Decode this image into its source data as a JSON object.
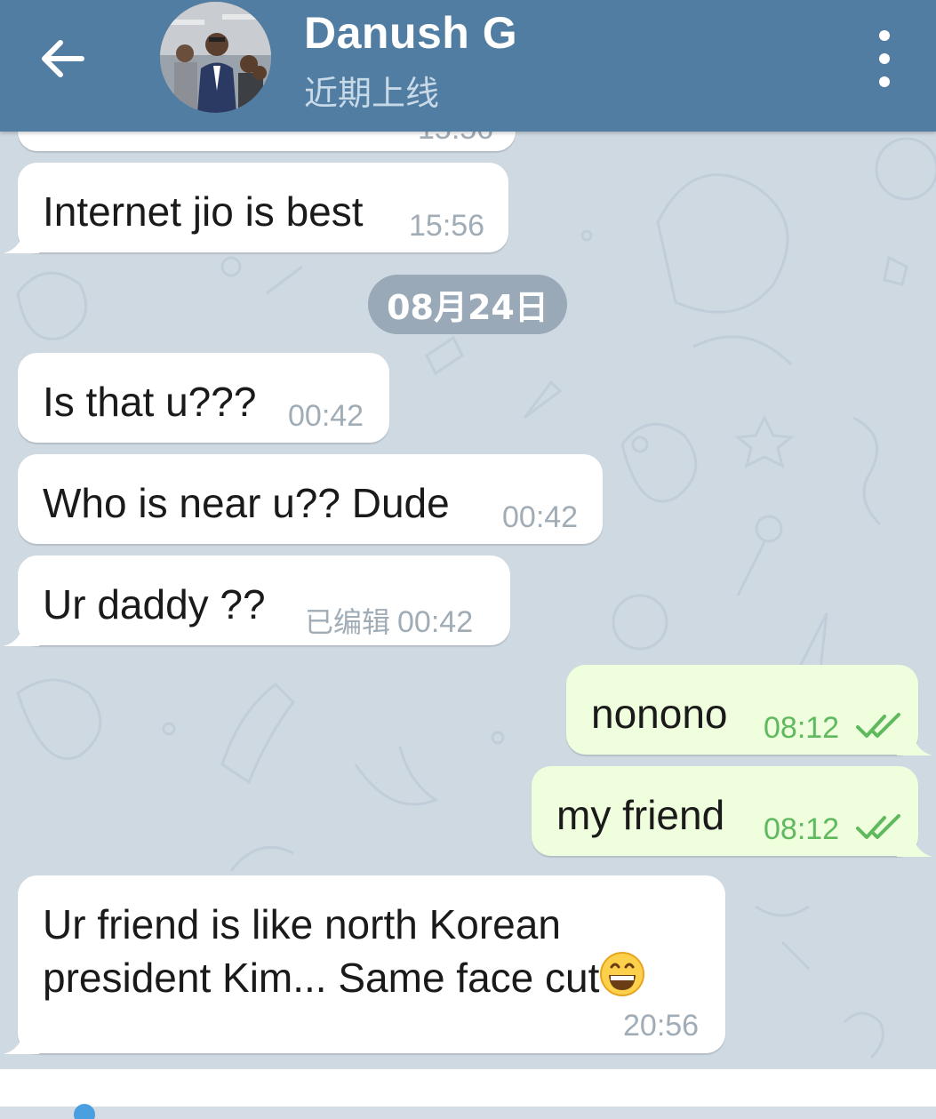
{
  "header": {
    "title": "Danush G",
    "subtitle": "近期上线",
    "accent_color": "#517da2",
    "back_icon": "arrow-left-icon",
    "menu_icon": "more-vertical-icon"
  },
  "messages": [
    {
      "direction": "in",
      "text": "Internet jio is best",
      "time": "15:56"
    },
    {
      "direction": "in",
      "text": "Is that u???",
      "time": "00:42"
    },
    {
      "direction": "in",
      "text": "Who is near u?? Dude",
      "time": "00:42"
    },
    {
      "direction": "in",
      "text": "Ur daddy ??",
      "edited_label": "已编辑",
      "time": "00:42"
    },
    {
      "direction": "out",
      "text": "nonono",
      "time": "08:12",
      "status": "read"
    },
    {
      "direction": "out",
      "text": "my friend",
      "time": "08:12",
      "status": "read"
    },
    {
      "direction": "in",
      "text_line1": "Ur friend is like north Korean",
      "text_line2": "president Kim... Same face cut",
      "emoji": "grinning-face-emoji",
      "time": "20:56"
    }
  ],
  "date_separator": "08月24日",
  "colors": {
    "incoming_bubble": "#ffffff",
    "outgoing_bubble": "#effedd",
    "outgoing_time": "#5fb95e",
    "chat_background": "#cfd9e2"
  }
}
